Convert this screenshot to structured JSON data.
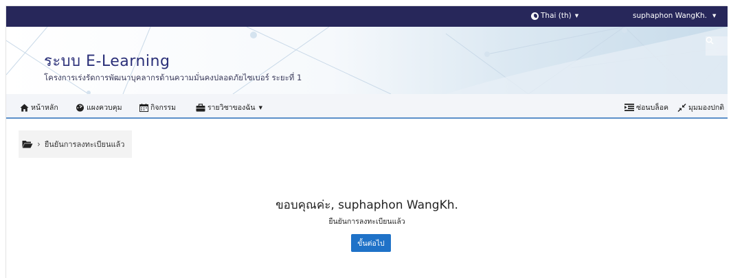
{
  "topbar": {
    "language_label": "Thai (th)",
    "user_name": "suphaphon WangKh."
  },
  "header": {
    "site_title": "ระบบ E-Learning",
    "site_subtitle": "โครงการเร่งรัดการพัฒนาบุคลากรด้านความมั่นคงปลอดภัยไซเบอร์ ระยะที่ 1",
    "search_icon": "search-icon"
  },
  "menu": {
    "home": "หน้าหลัก",
    "dashboard": "แผงควบคุม",
    "calendar": "กิจกรรม",
    "my_courses": "รายวิชาของฉัน",
    "hide_blocks": "ซ่อนบล็อค",
    "standard_view": "มุมมองปกติ"
  },
  "breadcrumb": {
    "current": "ยืนยันการลงทะเบียนแล้ว"
  },
  "main": {
    "thanks": "ขอบคุณค่ะ, suphaphon WangKh.",
    "confirmed": "ยืนยันการลงทะเบียนแล้ว",
    "continue_label": "ขั้นต่อไป"
  },
  "colors": {
    "navbar": "#27275a",
    "title": "#2a2f78",
    "accent": "#1f72c8",
    "menu_border": "#5b8fc9"
  }
}
